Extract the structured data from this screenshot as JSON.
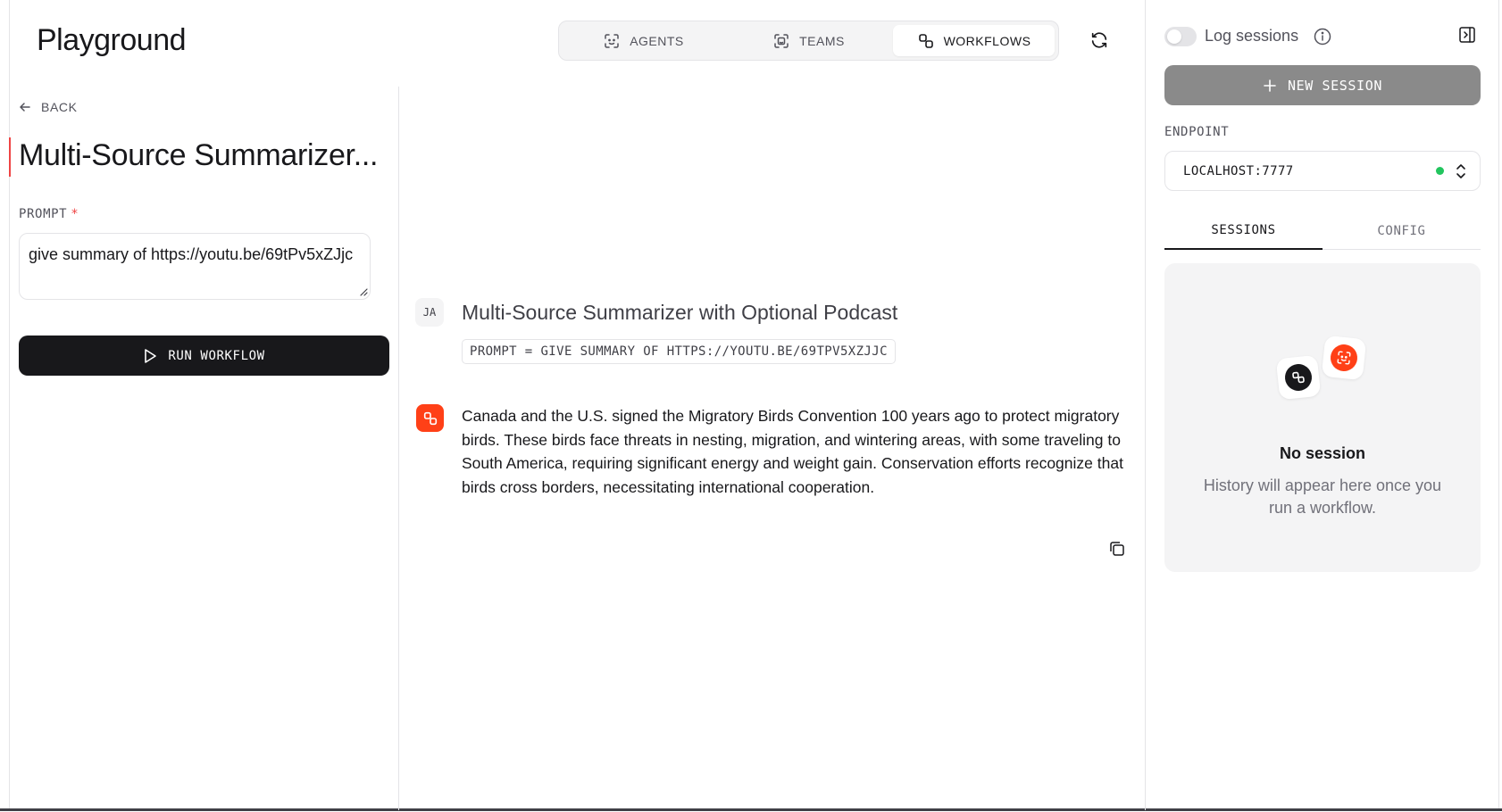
{
  "header": {
    "title": "Playground",
    "tabs": [
      {
        "label": "AGENTS",
        "icon": "agents-icon",
        "active": false
      },
      {
        "label": "TEAMS",
        "icon": "teams-icon",
        "active": false
      },
      {
        "label": "WORKFLOWS",
        "icon": "workflows-icon",
        "active": true
      }
    ],
    "refresh_icon": "refresh-icon"
  },
  "left_panel": {
    "back_label": "BACK",
    "workflow_title": "Multi-Source Summarizer...",
    "prompt_label": "PROMPT",
    "prompt_required_mark": "*",
    "prompt_value": "give summary of https://youtu.be/69tPv5xZJjc",
    "run_label": "RUN WORKFLOW"
  },
  "chat": {
    "user_initials": "JA",
    "run_title": "Multi-Source Summarizer with Optional Podcast",
    "prompt_chip": "PROMPT = GIVE SUMMARY OF HTTPS://YOUTU.BE/69TPV5XZJJC",
    "response": "Canada and the U.S. signed the Migratory Birds Convention 100 years ago to protect migratory birds. These birds face threats in nesting, migration, and wintering areas, with some traveling to South America, requiring significant energy and weight gain. Conservation efforts recognize that birds cross borders, necessitating international cooperation.",
    "copy_icon": "copy-icon"
  },
  "sidebar": {
    "log_sessions_label": "Log sessions",
    "log_sessions_enabled": false,
    "new_session_label": "NEW SESSION",
    "endpoint_label": "ENDPOINT",
    "endpoint_value": "LOCALHOST:7777",
    "endpoint_status_color": "#22c55e",
    "tabs": [
      {
        "label": "SESSIONS",
        "active": true
      },
      {
        "label": "CONFIG",
        "active": false
      }
    ],
    "empty_title": "No session",
    "empty_desc": "History will appear here once you run a workflow."
  },
  "colors": {
    "accent": "#ff4017",
    "primary_button": "#18181b",
    "disabled_button": "#8a8a8a",
    "status_online": "#22c55e",
    "required": "#ef4444"
  }
}
